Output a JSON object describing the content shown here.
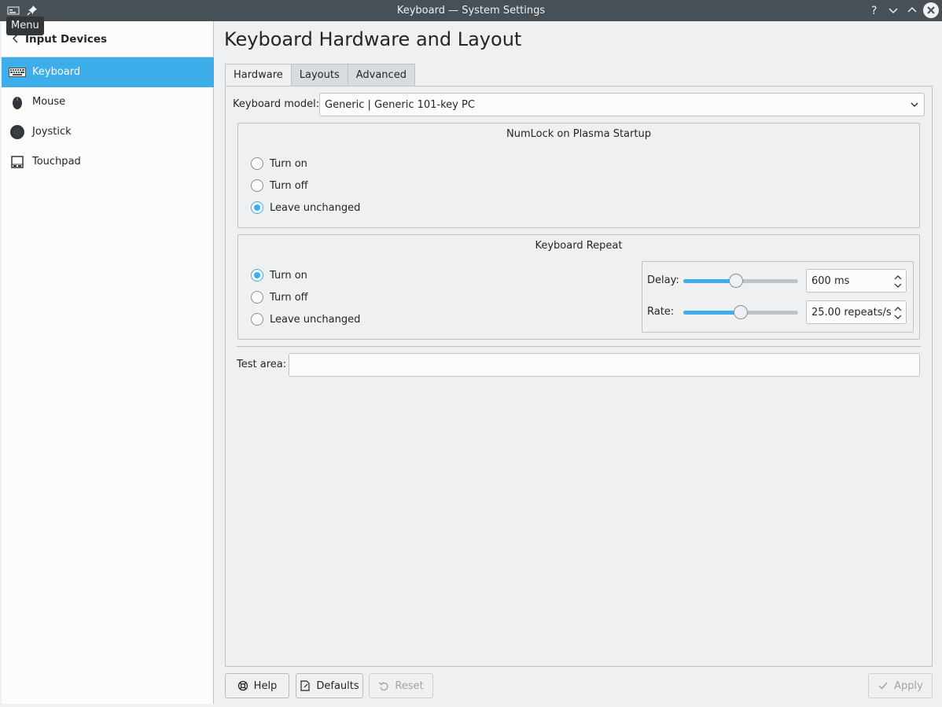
{
  "window": {
    "title": "Keyboard — System Settings",
    "tooltip": "Menu"
  },
  "sidebar": {
    "header_label": "Input Devices",
    "items": [
      {
        "label": "Keyboard",
        "icon": "keyboard-icon",
        "active": true
      },
      {
        "label": "Mouse",
        "icon": "mouse-icon",
        "active": false
      },
      {
        "label": "Joystick",
        "icon": "joystick-icon",
        "active": false
      },
      {
        "label": "Touchpad",
        "icon": "touchpad-icon",
        "active": false
      }
    ]
  },
  "main": {
    "page_title": "Keyboard Hardware and Layout",
    "tabs": [
      {
        "label": "Hardware",
        "active": true
      },
      {
        "label": "Layouts",
        "active": false
      },
      {
        "label": "Advanced",
        "active": false
      }
    ],
    "keyboard_model": {
      "label": "Keyboard model:",
      "value": "Generic | Generic 101-key PC"
    },
    "numlock": {
      "title": "NumLock on Plasma Startup",
      "options": [
        "Turn on",
        "Turn off",
        "Leave unchanged"
      ],
      "selected": "Leave unchanged"
    },
    "repeat": {
      "title": "Keyboard Repeat",
      "options": [
        "Turn on",
        "Turn off",
        "Leave unchanged"
      ],
      "selected": "Turn on",
      "delay": {
        "label": "Delay:",
        "value": "600 ms",
        "level": 0.46
      },
      "rate": {
        "label": "Rate:",
        "value": "25.00 repeats/s",
        "level": 0.5
      }
    },
    "test_area": {
      "label": "Test area:",
      "value": ""
    }
  },
  "buttons": {
    "help": "Help",
    "defaults": "Defaults",
    "reset": "Reset",
    "apply": "Apply"
  },
  "colors": {
    "accent": "#3daee9",
    "titlebar": "#475057",
    "window_bg": "#eff0f1"
  }
}
